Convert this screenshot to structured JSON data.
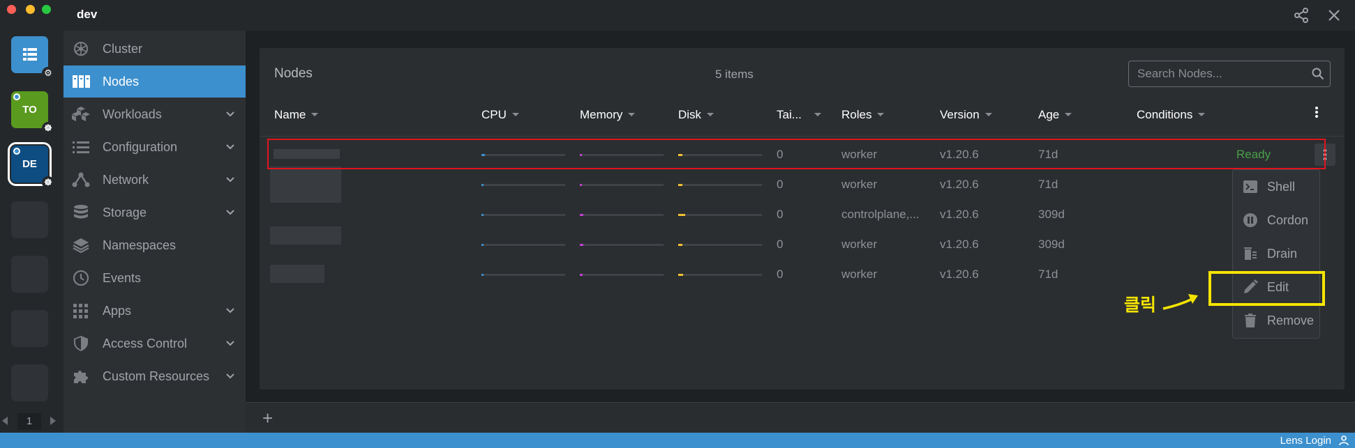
{
  "window": {
    "title": "dev"
  },
  "hotbar": {
    "items": [
      {
        "initials": "",
        "color": "#3d90ce",
        "badge": "gear-icon"
      },
      {
        "initials": "TO",
        "color": "#5a9a1f",
        "badge": "kubernetes-icon"
      },
      {
        "initials": "DE",
        "color": "#0d4d82",
        "badge": "kubernetes-icon"
      }
    ],
    "page": "1"
  },
  "sidebar": {
    "items": [
      {
        "label": "Cluster",
        "icon": "cluster-icon",
        "expandable": false,
        "active": false
      },
      {
        "label": "Nodes",
        "icon": "nodes-icon",
        "expandable": false,
        "active": true
      },
      {
        "label": "Workloads",
        "icon": "workloads-icon",
        "expandable": true,
        "active": false
      },
      {
        "label": "Configuration",
        "icon": "list-icon",
        "expandable": true,
        "active": false
      },
      {
        "label": "Network",
        "icon": "network-icon",
        "expandable": true,
        "active": false
      },
      {
        "label": "Storage",
        "icon": "storage-icon",
        "expandable": true,
        "active": false
      },
      {
        "label": "Namespaces",
        "icon": "layers-icon",
        "expandable": false,
        "active": false
      },
      {
        "label": "Events",
        "icon": "clock-icon",
        "expandable": false,
        "active": false
      },
      {
        "label": "Apps",
        "icon": "apps-grid-icon",
        "expandable": true,
        "active": false
      },
      {
        "label": "Access Control",
        "icon": "shield-icon",
        "expandable": true,
        "active": false
      },
      {
        "label": "Custom Resources",
        "icon": "puzzle-icon",
        "expandable": true,
        "active": false
      }
    ]
  },
  "nodes": {
    "title": "Nodes",
    "count": "5 items",
    "search_placeholder": "Search Nodes...",
    "columns": [
      "Name",
      "CPU",
      "Memory",
      "Disk",
      "Tai...",
      "Roles",
      "Version",
      "Age",
      "Conditions"
    ],
    "rows": [
      {
        "taints": "0",
        "roles": "worker",
        "version": "v1.20.6",
        "age": "71d",
        "conditions": "Ready",
        "cpu": 0.04,
        "memory": 0.01,
        "disk": 0.05
      },
      {
        "taints": "0",
        "roles": "worker",
        "version": "v1.20.6",
        "age": "71d",
        "conditions": "",
        "cpu": 0.01,
        "memory": 0.01,
        "disk": 0.05
      },
      {
        "taints": "0",
        "roles": "controlplane,...",
        "version": "v1.20.6",
        "age": "309d",
        "conditions": "",
        "cpu": 0.02,
        "memory": 0.04,
        "disk": 0.08
      },
      {
        "taints": "0",
        "roles": "worker",
        "version": "v1.20.6",
        "age": "309d",
        "conditions": "",
        "cpu": 0.01,
        "memory": 0.04,
        "disk": 0.05
      },
      {
        "taints": "0",
        "roles": "worker",
        "version": "v1.20.6",
        "age": "71d",
        "conditions": "",
        "cpu": 0.01,
        "memory": 0.03,
        "disk": 0.06
      }
    ]
  },
  "context_menu": {
    "items": [
      {
        "label": "Shell",
        "icon": "terminal-icon"
      },
      {
        "label": "Cordon",
        "icon": "pause-icon"
      },
      {
        "label": "Drain",
        "icon": "drain-icon"
      },
      {
        "label": "Edit",
        "icon": "pencil-icon"
      },
      {
        "label": "Remove",
        "icon": "trash-icon"
      }
    ]
  },
  "annotation": {
    "text": "클릭"
  },
  "statusbar": {
    "login": "Lens Login"
  },
  "colors": {
    "accent": "#3d90ce",
    "ready": "#48a048",
    "cpu": "#3d90ce",
    "memory": "#c040d0",
    "disk": "#f0c030",
    "highlight_red": "#e0141e",
    "highlight_yellow": "#f5e400"
  }
}
